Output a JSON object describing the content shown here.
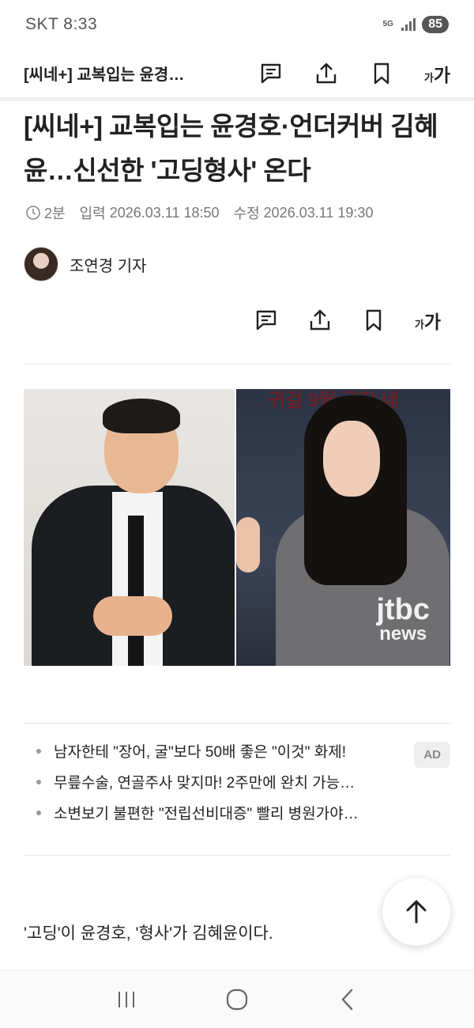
{
  "status_bar": {
    "carrier_time": "SKT 8:33",
    "network": "5G",
    "battery": "85"
  },
  "top_bar": {
    "title": "[씨네+] 교복입는 윤경…",
    "font_small": "가",
    "font_big": "가"
  },
  "article": {
    "headline": "[씨네+] 교복입는 윤경호·언더커버 김혜윤…신선한 '고딩형사' 온다",
    "read_time": "2분",
    "published_label": "입력",
    "published": "2026.03.11 18:50",
    "modified_label": "수정",
    "modified": "2026.03.11 19:30",
    "author": "조연경 기자",
    "watermark_top": "jtbc",
    "watermark_bottom": "news",
    "banner_fragment": "귀걸 9월 극장 네",
    "first_paragraph": "'고딩'이 윤경호, '형사'가 김혜윤이다."
  },
  "ads": {
    "badge": "AD",
    "items": [
      "남자한테 \"장어, 굴\"보다 50배 좋은 \"이것\" 화제!",
      "무릎수술, 연골주사 맞지마! 2주만에 완치 가능…",
      "소변보기 불편한 \"전립선비대증\" 빨리 병원가야…"
    ]
  },
  "icons": {
    "comment": "comment-icon",
    "share": "share-icon",
    "bookmark": "bookmark-icon",
    "font_size": "font-size-icon",
    "clock": "clock-icon",
    "scroll_top": "arrow-up-icon",
    "nav_recent": "recent-apps-icon",
    "nav_home": "home-icon",
    "nav_back": "back-icon"
  }
}
